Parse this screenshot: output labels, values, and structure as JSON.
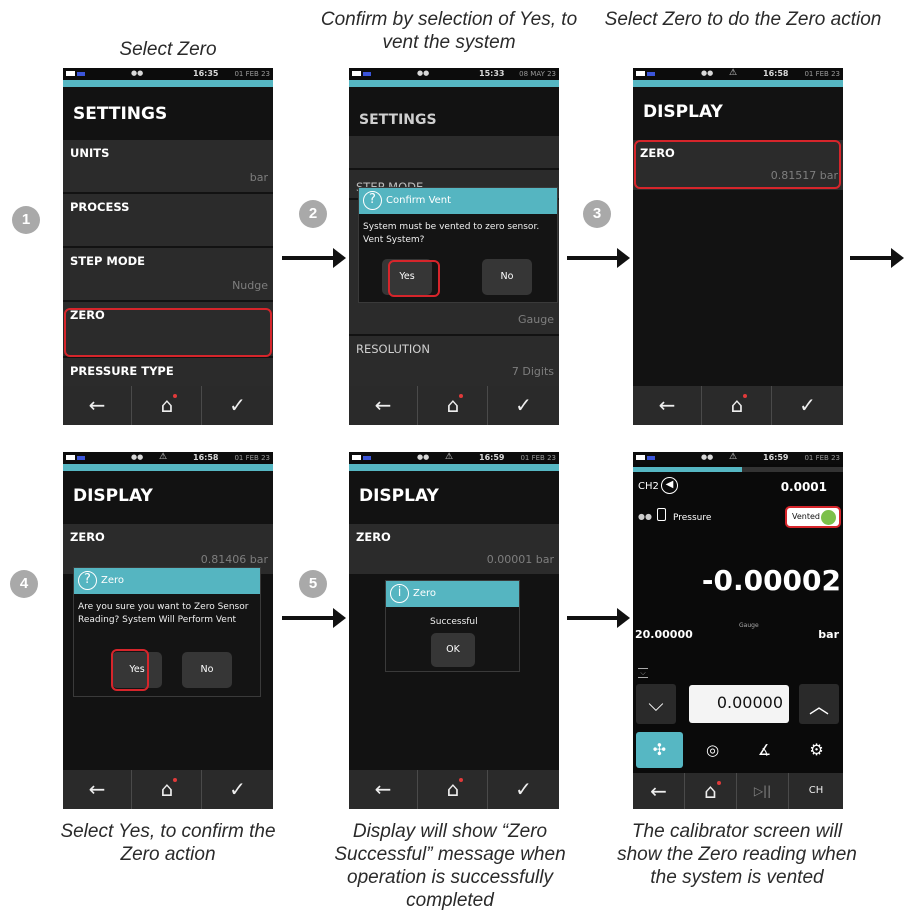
{
  "captions": {
    "c1": "Select Zero",
    "c2": "Confirm by selection of Yes, to vent the system",
    "c3": "Select Zero to do the Zero action",
    "c4": "Select Yes, to confirm the Zero action",
    "c5": "Display will show “Zero Successful” message when operation is successfully completed",
    "c6": "The calibrator screen will show the Zero reading when the system is vented"
  },
  "steps": [
    "1",
    "2",
    "3",
    "4",
    "5"
  ],
  "icons": {
    "back": "←",
    "home": "⌂",
    "check": "✓",
    "question": "?",
    "info": "i",
    "warning": "⚠",
    "dots": "●●",
    "chevron_down": "⌵",
    "chevron_up": "︿",
    "gear": "⚙",
    "play_pause": "▷||"
  },
  "colors": {
    "teal": "#56b7c3",
    "red_highlight": "#d6252b",
    "dark": "#121212",
    "row": "#2b2b2b"
  },
  "screen1": {
    "time": "16:35",
    "date": "01 FEB 23",
    "title": "SETTINGS",
    "rows": [
      {
        "label": "UNITS",
        "value": "bar"
      },
      {
        "label": "PROCESS",
        "value": ""
      },
      {
        "label": "STEP MODE",
        "value": "Nudge"
      },
      {
        "label": "ZERO",
        "value": ""
      },
      {
        "label": "PRESSURE TYPE",
        "value": ""
      }
    ]
  },
  "screen2": {
    "time": "15:33",
    "date": "08 MAY 23",
    "title": "SETTINGS",
    "rows": [
      {
        "label": "STEP MODE",
        "value": ""
      },
      {
        "label": "",
        "value": "Gauge"
      },
      {
        "label": "RESOLUTION",
        "value": "7 Digits"
      }
    ],
    "dialog": {
      "title": "Confirm Vent",
      "message": "System must be vented to zero sensor. Vent System?",
      "yes": "Yes",
      "no": "No"
    }
  },
  "screen3": {
    "time": "16:58",
    "date": "01 FEB 23",
    "title": "DISPLAY",
    "row": {
      "label": "ZERO",
      "value": "0.81517 bar"
    }
  },
  "screen4": {
    "time": "16:58",
    "date": "01 FEB 23",
    "title": "DISPLAY",
    "row": {
      "label": "ZERO",
      "value": "0.81406 bar"
    },
    "dialog": {
      "title": "Zero",
      "message": "Are you sure you want to Zero Sensor Reading? System Will Perform Vent",
      "yes": "Yes",
      "no": "No"
    }
  },
  "screen5": {
    "time": "16:59",
    "date": "01 FEB 23",
    "title": "DISPLAY",
    "row": {
      "label": "ZERO",
      "value": "0.00001 bar"
    },
    "dialog": {
      "title": "Zero",
      "message": "Successful",
      "ok": "OK"
    }
  },
  "screen6": {
    "time": "16:59",
    "date": "01 FEB 23",
    "channel": "CH2",
    "top_value": "0.0001",
    "mode": "Pressure",
    "vent_status": "Vented",
    "reading": "-0.00002",
    "range": "20.00000",
    "pressure_type": "Gauge",
    "unit": "bar",
    "setpoint": "0.00000",
    "ch_button": "CH"
  }
}
